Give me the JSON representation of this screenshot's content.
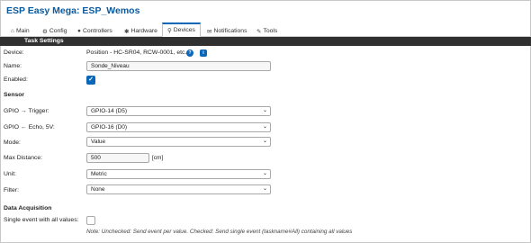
{
  "app": {
    "title": "ESP Easy Mega: ESP_Wemos"
  },
  "tabs": [
    {
      "icon": "⌂",
      "label": "Main"
    },
    {
      "icon": "⚙",
      "label": "Config"
    },
    {
      "icon": "●",
      "label": "Controllers"
    },
    {
      "icon": "✱",
      "label": "Hardware"
    },
    {
      "icon": "⚲",
      "label": "Devices"
    },
    {
      "icon": "✉",
      "label": "Notifications"
    },
    {
      "icon": "✎",
      "label": "Tools"
    }
  ],
  "header": {
    "title": "Task Settings"
  },
  "form": {
    "device_label": "Device:",
    "device_value": "Position - HC-SR04, RCW-0001, etc.",
    "device_help_icon": "?",
    "device_info_icon": "i",
    "name_label": "Name:",
    "name_value": "Sonde_Niveau",
    "enabled_label": "Enabled:",
    "enabled_check": "✓"
  },
  "sensor": {
    "heading": "Sensor",
    "trigger_label": "GPIO → Trigger:",
    "trigger_value": "GPIO-14 (D5)",
    "echo_label": "GPIO ← Echo, 5V:",
    "echo_value": "GPIO-16 (D0)",
    "mode_label": "Mode:",
    "mode_value": "Value",
    "maxdist_label": "Max Distance:",
    "maxdist_value": "500",
    "maxdist_unit": "[cm]",
    "unit_label": "Unit:",
    "unit_value": "Metric",
    "filter_label": "Filter:",
    "filter_value": "None",
    "dropdown_arrow": "⌄"
  },
  "acquisition": {
    "heading": "Data Acquisition",
    "single_event_label": "Single event with all values:",
    "note": "Note: Unchecked: Send event per value. Checked: Send single event (taskname#All) containing all values"
  }
}
